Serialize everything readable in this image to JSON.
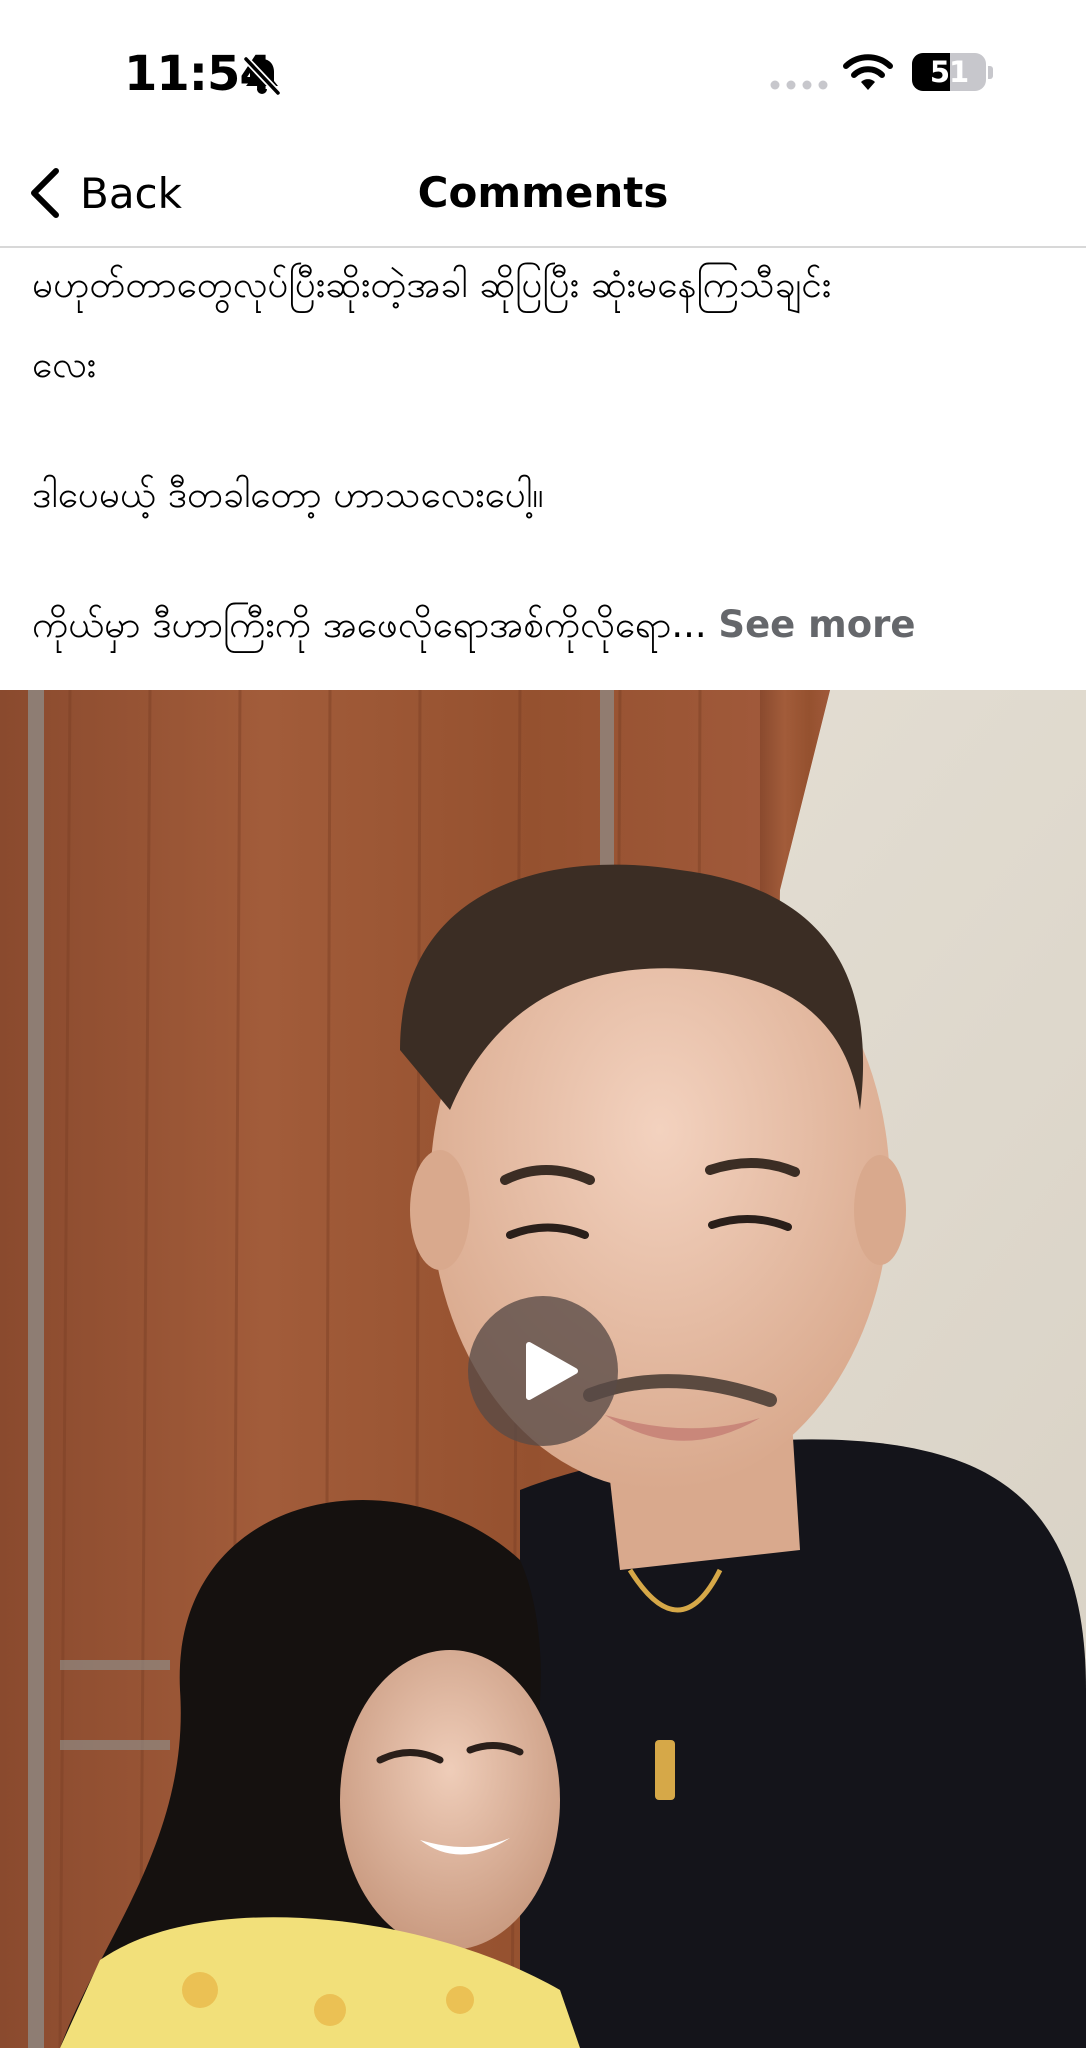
{
  "status_bar": {
    "time": "11:54",
    "battery_level": "51",
    "battery_fraction": 0.51,
    "icons": [
      "bell-slash-icon",
      "signal-dots-icon",
      "wifi-icon",
      "battery-icon"
    ]
  },
  "nav": {
    "back_label": "Back",
    "title": "Comments"
  },
  "post": {
    "line1": "မဟုတ်တာတွေလုပ်ပြီးဆိုးတဲ့အခါ ဆိုပြပြီး ဆုံးမနေကြသီချင်း",
    "line2": "လေး",
    "line3": "ဒါပေမယ့် ဒီတခါတော့ ဟာသလေးပေါ့။",
    "line4": "ကိုယ်မှာ ဒီဟာကြီးကို အဖေလိုရောအစ်ကိုလိုရော...",
    "see_more": "See more"
  },
  "video": {
    "play_icon": "play-icon"
  },
  "colors": {
    "see_more": "#65676b",
    "divider": "#d8d8d8",
    "play_button_bg": "#584a46"
  }
}
